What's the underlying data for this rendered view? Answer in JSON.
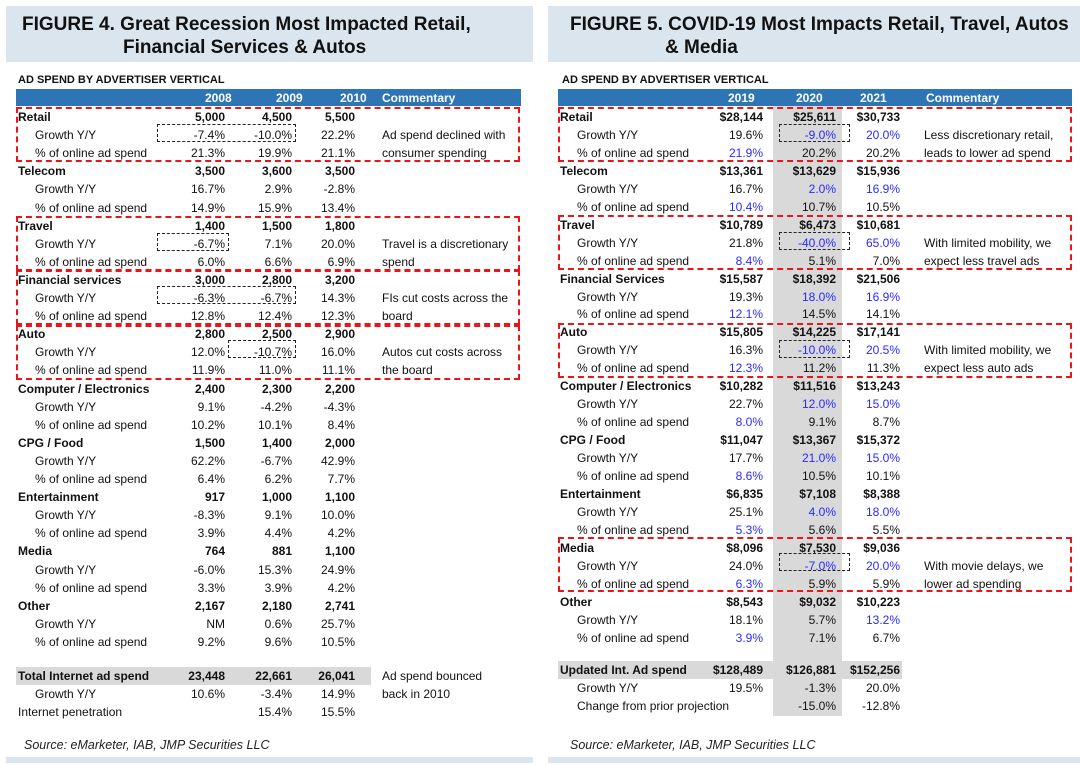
{
  "figure4": {
    "title_line1": "FIGURE 4.  Great Recession Most Impacted Retail,",
    "title_line2": "Financial Services & Autos",
    "subtitle": "AD SPEND BY ADVERTISER VERTICAL",
    "columns": [
      "",
      "2008",
      "2009",
      "2010",
      "Commentary"
    ],
    "rows": [
      {
        "label": "Retail",
        "type": "group",
        "values": [
          "5,000",
          "4,500",
          "5,500"
        ],
        "commentary": ""
      },
      {
        "label": "Growth Y/Y",
        "type": "sub",
        "values": [
          "-7.4%",
          "-10.0%",
          "22.2%"
        ],
        "commentary": "Ad spend declined with"
      },
      {
        "label": "% of online ad spend",
        "type": "sub",
        "values": [
          "21.3%",
          "19.9%",
          "21.1%"
        ],
        "commentary": "consumer spending"
      },
      {
        "label": "Telecom",
        "type": "group",
        "values": [
          "3,500",
          "3,600",
          "3,500"
        ],
        "commentary": ""
      },
      {
        "label": "Growth Y/Y",
        "type": "sub",
        "values": [
          "16.7%",
          "2.9%",
          "-2.8%"
        ],
        "commentary": ""
      },
      {
        "label": "% of online ad spend",
        "type": "sub",
        "values": [
          "14.9%",
          "15.9%",
          "13.4%"
        ],
        "commentary": ""
      },
      {
        "label": "Travel",
        "type": "group",
        "values": [
          "1,400",
          "1,500",
          "1,800"
        ],
        "commentary": ""
      },
      {
        "label": "Growth Y/Y",
        "type": "sub",
        "values": [
          "-6.7%",
          "7.1%",
          "20.0%"
        ],
        "commentary": "Travel is a discretionary"
      },
      {
        "label": "% of online ad spend",
        "type": "sub",
        "values": [
          "6.0%",
          "6.6%",
          "6.9%"
        ],
        "commentary": "spend"
      },
      {
        "label": "Financial services",
        "type": "group",
        "values": [
          "3,000",
          "2,800",
          "3,200"
        ],
        "commentary": ""
      },
      {
        "label": "Growth Y/Y",
        "type": "sub",
        "values": [
          "-6.3%",
          "-6.7%",
          "14.3%"
        ],
        "commentary": "FIs cut costs across the"
      },
      {
        "label": "% of online ad spend",
        "type": "sub",
        "values": [
          "12.8%",
          "12.4%",
          "12.3%"
        ],
        "commentary": "board"
      },
      {
        "label": "Auto",
        "type": "group",
        "values": [
          "2,800",
          "2,500",
          "2,900"
        ],
        "commentary": ""
      },
      {
        "label": "Growth Y/Y",
        "type": "sub",
        "values": [
          "12.0%",
          "-10.7%",
          "16.0%"
        ],
        "commentary": "Autos cut costs across"
      },
      {
        "label": "% of online ad spend",
        "type": "sub",
        "values": [
          "11.9%",
          "11.0%",
          "11.1%"
        ],
        "commentary": "the board"
      },
      {
        "label": "Computer / Electronics",
        "type": "group",
        "values": [
          "2,400",
          "2,300",
          "2,200"
        ],
        "commentary": ""
      },
      {
        "label": "Growth Y/Y",
        "type": "sub",
        "values": [
          "9.1%",
          "-4.2%",
          "-4.3%"
        ],
        "commentary": ""
      },
      {
        "label": "% of online ad spend",
        "type": "sub",
        "values": [
          "10.2%",
          "10.1%",
          "8.4%"
        ],
        "commentary": ""
      },
      {
        "label": "CPG / Food",
        "type": "group",
        "values": [
          "1,500",
          "1,400",
          "2,000"
        ],
        "commentary": ""
      },
      {
        "label": "Growth Y/Y",
        "type": "sub",
        "values": [
          "62.2%",
          "-6.7%",
          "42.9%"
        ],
        "commentary": ""
      },
      {
        "label": "% of online ad spend",
        "type": "sub",
        "values": [
          "6.4%",
          "6.2%",
          "7.7%"
        ],
        "commentary": ""
      },
      {
        "label": "Entertainment",
        "type": "group",
        "values": [
          "917",
          "1,000",
          "1,100"
        ],
        "commentary": ""
      },
      {
        "label": "Growth Y/Y",
        "type": "sub",
        "values": [
          "-8.3%",
          "9.1%",
          "10.0%"
        ],
        "commentary": ""
      },
      {
        "label": "% of online ad spend",
        "type": "sub",
        "values": [
          "3.9%",
          "4.4%",
          "4.2%"
        ],
        "commentary": ""
      },
      {
        "label": "Media",
        "type": "group",
        "values": [
          "764",
          "881",
          "1,100"
        ],
        "commentary": ""
      },
      {
        "label": "Growth Y/Y",
        "type": "sub",
        "values": [
          "-6.0%",
          "15.3%",
          "24.9%"
        ],
        "commentary": ""
      },
      {
        "label": "% of online ad spend",
        "type": "sub",
        "values": [
          "3.3%",
          "3.9%",
          "4.2%"
        ],
        "commentary": ""
      },
      {
        "label": "Other",
        "type": "group",
        "values": [
          "2,167",
          "2,180",
          "2,741"
        ],
        "commentary": ""
      },
      {
        "label": "Growth Y/Y",
        "type": "sub",
        "values": [
          "NM",
          "0.6%",
          "25.7%"
        ],
        "commentary": ""
      },
      {
        "label": "% of online ad spend",
        "type": "sub",
        "values": [
          "9.2%",
          "9.6%",
          "10.5%"
        ],
        "commentary": ""
      }
    ],
    "totals": [
      {
        "label": "Total Internet ad spend",
        "type": "group",
        "values": [
          "23,448",
          "22,661",
          "26,041"
        ],
        "commentary": "Ad spend bounced"
      },
      {
        "label": "Growth Y/Y",
        "type": "sub",
        "values": [
          "10.6%",
          "-3.4%",
          "14.9%"
        ],
        "commentary": "back in 2010"
      },
      {
        "label": "Internet penetration",
        "type": "plain",
        "values": [
          "",
          "15.4%",
          "15.5%"
        ],
        "commentary": ""
      }
    ],
    "source": "Source: eMarketer, IAB, JMP Securities LLC"
  },
  "figure5": {
    "title_line1": "FIGURE 5. COVID-19 Most Impacts Retail, Travel, Autos",
    "title_line2": "& Media",
    "subtitle": "AD SPEND BY ADVERTISER VERTICAL",
    "columns": [
      "",
      "2019",
      "2020",
      "2021",
      "Commentary"
    ],
    "highlight_color": "#2a2aff",
    "rows": [
      {
        "label": "Retail",
        "type": "group",
        "values": [
          "$28,144",
          "$25,611",
          "$30,733"
        ],
        "blue": [
          false,
          false,
          false
        ],
        "commentary": ""
      },
      {
        "label": "Growth Y/Y",
        "type": "sub",
        "values": [
          "19.6%",
          "-9.0%",
          "20.0%"
        ],
        "blue": [
          false,
          true,
          true
        ],
        "commentary": "Less discretionary retail,"
      },
      {
        "label": "% of online ad spend",
        "type": "sub",
        "values": [
          "21.9%",
          "20.2%",
          "20.2%"
        ],
        "blue": [
          true,
          false,
          false
        ],
        "commentary": "leads to lower ad spend"
      },
      {
        "label": "Telecom",
        "type": "group",
        "values": [
          "$13,361",
          "$13,629",
          "$15,936"
        ],
        "blue": [
          false,
          false,
          false
        ],
        "commentary": ""
      },
      {
        "label": "Growth Y/Y",
        "type": "sub",
        "values": [
          "16.7%",
          "2.0%",
          "16.9%"
        ],
        "blue": [
          false,
          true,
          true
        ],
        "commentary": ""
      },
      {
        "label": "% of online ad spend",
        "type": "sub",
        "values": [
          "10.4%",
          "10.7%",
          "10.5%"
        ],
        "blue": [
          true,
          false,
          false
        ],
        "commentary": ""
      },
      {
        "label": "Travel",
        "type": "group",
        "values": [
          "$10,789",
          "$6,473",
          "$10,681"
        ],
        "blue": [
          false,
          false,
          false
        ],
        "commentary": ""
      },
      {
        "label": "Growth Y/Y",
        "type": "sub",
        "values": [
          "21.8%",
          "-40.0%",
          "65.0%"
        ],
        "blue": [
          false,
          true,
          true
        ],
        "commentary": "With limited mobility, we"
      },
      {
        "label": "% of online ad spend",
        "type": "sub",
        "values": [
          "8.4%",
          "5.1%",
          "7.0%"
        ],
        "blue": [
          true,
          false,
          false
        ],
        "commentary": "expect less travel ads"
      },
      {
        "label": "Financial Services",
        "type": "group",
        "values": [
          "$15,587",
          "$18,392",
          "$21,506"
        ],
        "blue": [
          false,
          false,
          false
        ],
        "commentary": ""
      },
      {
        "label": "Growth Y/Y",
        "type": "sub",
        "values": [
          "19.3%",
          "18.0%",
          "16.9%"
        ],
        "blue": [
          false,
          true,
          true
        ],
        "commentary": ""
      },
      {
        "label": "% of online ad spend",
        "type": "sub",
        "values": [
          "12.1%",
          "14.5%",
          "14.1%"
        ],
        "blue": [
          true,
          false,
          false
        ],
        "commentary": ""
      },
      {
        "label": "Auto",
        "type": "group",
        "values": [
          "$15,805",
          "$14,225",
          "$17,141"
        ],
        "blue": [
          false,
          false,
          false
        ],
        "commentary": ""
      },
      {
        "label": "Growth Y/Y",
        "type": "sub",
        "values": [
          "16.3%",
          "-10.0%",
          "20.5%"
        ],
        "blue": [
          false,
          true,
          true
        ],
        "commentary": "With limited mobility, we"
      },
      {
        "label": "% of online ad spend",
        "type": "sub",
        "values": [
          "12.3%",
          "11.2%",
          "11.3%"
        ],
        "blue": [
          true,
          false,
          false
        ],
        "commentary": "expect less auto ads"
      },
      {
        "label": "Computer / Electronics",
        "type": "group",
        "values": [
          "$10,282",
          "$11,516",
          "$13,243"
        ],
        "blue": [
          false,
          false,
          false
        ],
        "commentary": ""
      },
      {
        "label": "Growth Y/Y",
        "type": "sub",
        "values": [
          "22.7%",
          "12.0%",
          "15.0%"
        ],
        "blue": [
          false,
          true,
          true
        ],
        "commentary": ""
      },
      {
        "label": "% of online ad spend",
        "type": "sub",
        "values": [
          "8.0%",
          "9.1%",
          "8.7%"
        ],
        "blue": [
          true,
          false,
          false
        ],
        "commentary": ""
      },
      {
        "label": "CPG / Food",
        "type": "group",
        "values": [
          "$11,047",
          "$13,367",
          "$15,372"
        ],
        "blue": [
          false,
          false,
          false
        ],
        "commentary": ""
      },
      {
        "label": "Growth Y/Y",
        "type": "sub",
        "values": [
          "17.7%",
          "21.0%",
          "15.0%"
        ],
        "blue": [
          false,
          true,
          true
        ],
        "commentary": ""
      },
      {
        "label": "% of online ad spend",
        "type": "sub",
        "values": [
          "8.6%",
          "10.5%",
          "10.1%"
        ],
        "blue": [
          true,
          false,
          false
        ],
        "commentary": ""
      },
      {
        "label": "Entertainment",
        "type": "group",
        "values": [
          "$6,835",
          "$7,108",
          "$8,388"
        ],
        "blue": [
          false,
          false,
          false
        ],
        "commentary": ""
      },
      {
        "label": "Growth Y/Y",
        "type": "sub",
        "values": [
          "25.1%",
          "4.0%",
          "18.0%"
        ],
        "blue": [
          false,
          true,
          true
        ],
        "commentary": ""
      },
      {
        "label": "% of online ad spend",
        "type": "sub",
        "values": [
          "5.3%",
          "5.6%",
          "5.5%"
        ],
        "blue": [
          true,
          false,
          false
        ],
        "commentary": ""
      },
      {
        "label": "Media",
        "type": "group",
        "values": [
          "$8,096",
          "$7,530",
          "$9,036"
        ],
        "blue": [
          false,
          false,
          false
        ],
        "commentary": ""
      },
      {
        "label": "Growth Y/Y",
        "type": "sub",
        "values": [
          "24.0%",
          "-7.0%",
          "20.0%"
        ],
        "blue": [
          false,
          true,
          true
        ],
        "commentary": "With movie delays, we"
      },
      {
        "label": "% of online ad spend",
        "type": "sub",
        "values": [
          "6.3%",
          "5.9%",
          "5.9%"
        ],
        "blue": [
          true,
          false,
          false
        ],
        "commentary": "lower ad spending"
      },
      {
        "label": "Other",
        "type": "group",
        "values": [
          "$8,543",
          "$9,032",
          "$10,223"
        ],
        "blue": [
          false,
          false,
          false
        ],
        "commentary": ""
      },
      {
        "label": "Growth Y/Y",
        "type": "sub",
        "values": [
          "18.1%",
          "5.7%",
          "13.2%"
        ],
        "blue": [
          false,
          false,
          true
        ],
        "commentary": ""
      },
      {
        "label": "% of online ad spend",
        "type": "sub",
        "values": [
          "3.9%",
          "7.1%",
          "6.7%"
        ],
        "blue": [
          true,
          false,
          false
        ],
        "commentary": ""
      }
    ],
    "totals": [
      {
        "label": "Updated Int. Ad spend",
        "type": "group",
        "values": [
          "$128,489",
          "$126,881",
          "$152,256"
        ],
        "blue": [
          false,
          false,
          false
        ],
        "commentary": ""
      },
      {
        "label": "Growth Y/Y",
        "type": "sub",
        "values": [
          "19.5%",
          "-1.3%",
          "20.0%"
        ],
        "blue": [
          false,
          false,
          false
        ],
        "commentary": ""
      },
      {
        "label": "Change from prior projection",
        "type": "sub",
        "values": [
          "",
          "-15.0%",
          "-12.8%"
        ],
        "blue": [
          false,
          false,
          false
        ],
        "commentary": ""
      }
    ],
    "source": "Source: eMarketer, IAB, JMP Securities LLC"
  }
}
